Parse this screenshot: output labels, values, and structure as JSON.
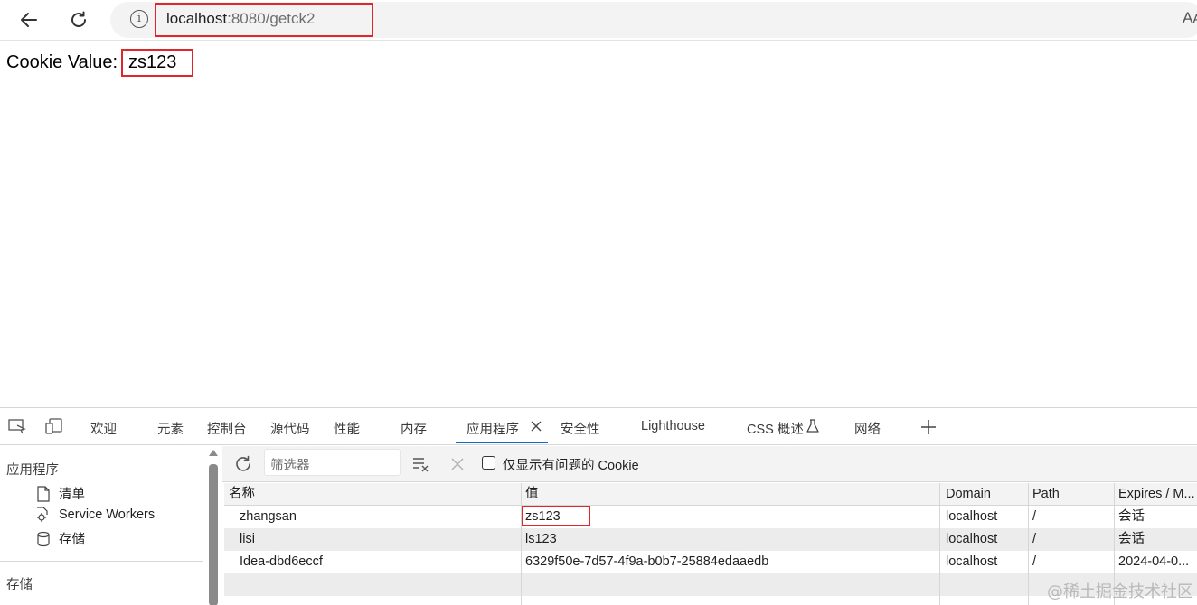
{
  "browser": {
    "url_host": "localhost",
    "url_rest": ":8080/getck2",
    "read_aloud_glyph": "Aᴀ"
  },
  "page": {
    "cookie_label": "Cookie Value:",
    "cookie_value": "zs123"
  },
  "devtools": {
    "tabs": [
      "欢迎",
      "元素",
      "控制台",
      "源代码",
      "性能",
      "内存",
      "应用程序",
      "安全性",
      "Lighthouse",
      "CSS 概述",
      "网络"
    ],
    "active_tab": "应用程序",
    "sidebar": {
      "heading_app": "应用程序",
      "items": [
        "清单",
        "Service Workers",
        "存储"
      ],
      "heading_storage": "存储"
    },
    "toolbar": {
      "filter_placeholder": "筛选器",
      "only_issues_label": "仅显示有问题的 Cookie"
    },
    "table": {
      "columns": [
        "名称",
        "值",
        "Domain",
        "Path",
        "Expires / M..."
      ],
      "rows": [
        {
          "name": "zhangsan",
          "value": "zs123",
          "domain": "localhost",
          "path": "/",
          "expires": "会话"
        },
        {
          "name": "lisi",
          "value": "ls123",
          "domain": "localhost",
          "path": "/",
          "expires": "会话"
        },
        {
          "name": "Idea-dbd6eccf",
          "value": "6329f50e-7d57-4f9a-b0b7-25884edaaedb",
          "domain": "localhost",
          "path": "/",
          "expires": "2024-04-0..."
        }
      ]
    }
  },
  "watermark": "@稀土掘金技术社区",
  "colors": {
    "highlight": "#e0252b",
    "active_tab_underline": "#0f6cbd"
  }
}
